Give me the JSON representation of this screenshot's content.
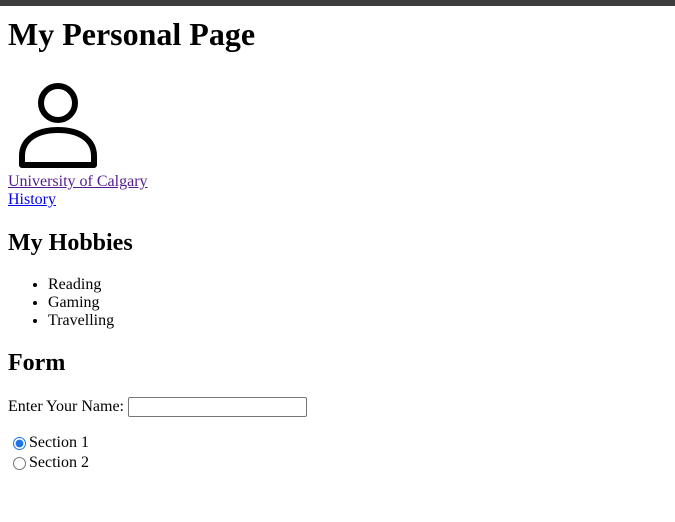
{
  "page": {
    "title": "My Personal Page"
  },
  "avatar": {
    "icon": "user-icon"
  },
  "links": [
    {
      "label": "University of Calgary",
      "visited": true
    },
    {
      "label": "History",
      "visited": false
    }
  ],
  "hobbies": {
    "heading": "My Hobbies",
    "items": [
      "Reading",
      "Gaming",
      "Travelling"
    ]
  },
  "form": {
    "heading": "Form",
    "name_label": "Enter Your Name:",
    "name_value": "",
    "name_placeholder": "",
    "options": [
      {
        "label": "Section 1",
        "checked": true
      },
      {
        "label": "Section 2",
        "checked": false
      }
    ]
  },
  "colors": {
    "visited_link": "#551a8b",
    "link": "#0000ee",
    "top_bar": "#3c3c3c",
    "radio_accent": "#1a73e8"
  }
}
